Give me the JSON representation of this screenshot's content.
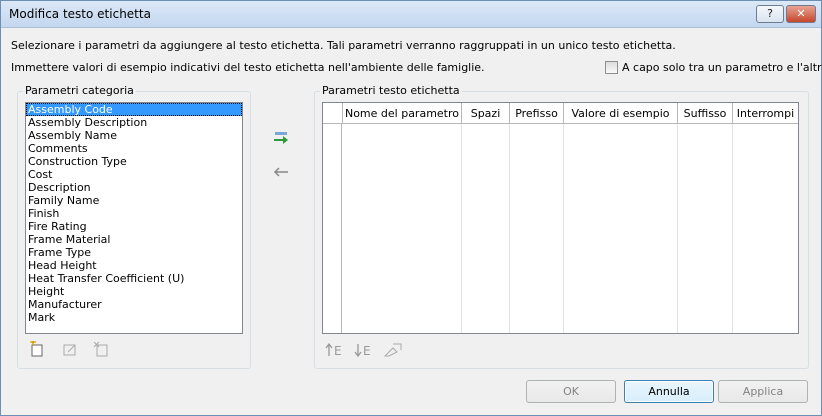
{
  "window": {
    "title": "Modifica testo etichetta",
    "help_label": "?",
    "close_label": "✕"
  },
  "intro": {
    "line1": "Selezionare i parametri da aggiungere al testo etichetta. Tali parametri verranno raggruppati in un unico testo etichetta.",
    "line2": "Immettere valori di esempio indicativi del testo etichetta nell'ambiente delle famiglie."
  },
  "wrap_option": {
    "label": "A capo solo tra un parametro e l'altro",
    "checked": false
  },
  "category_params": {
    "title": "Parametri categoria",
    "items": [
      "Assembly Code",
      "Assembly Description",
      "Assembly Name",
      "Comments",
      "Construction Type",
      "Cost",
      "Description",
      "Family Name",
      "Finish",
      "Fire Rating",
      "Frame Material",
      "Frame Type",
      "Head Height",
      "Heat Transfer Coefficient (U)",
      "Height",
      "Manufacturer",
      "Mark"
    ],
    "selected": "Assembly Code"
  },
  "label_params": {
    "title": "Parametri testo etichetta",
    "columns": [
      "Nome del parametro",
      "Spazi",
      "Prefisso",
      "Valore di esempio",
      "Suffisso",
      "Interrompi"
    ]
  },
  "footer": {
    "ok": "OK",
    "cancel": "Annulla",
    "apply": "Applica"
  },
  "colors": {
    "accent": "#3399ff",
    "titlebar": "#c4d7ef",
    "close": "#c6462d"
  }
}
